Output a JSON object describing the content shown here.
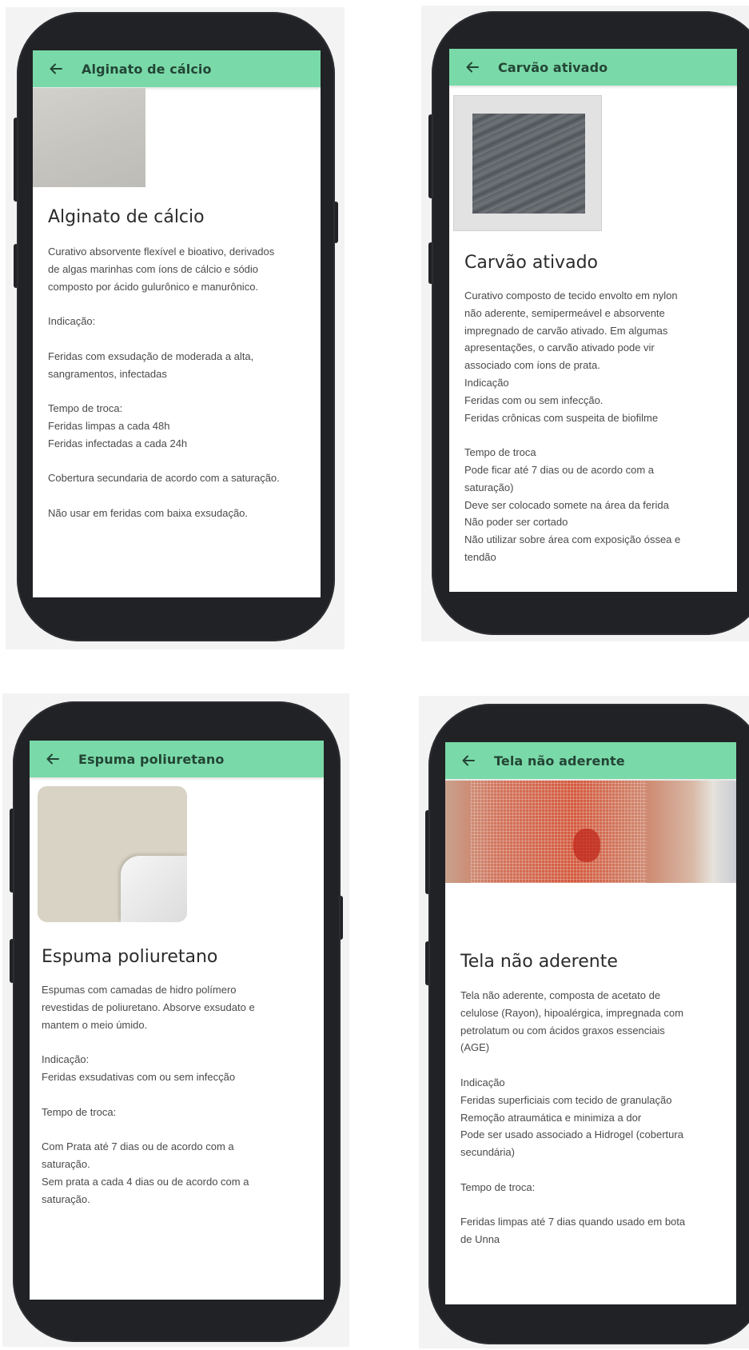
{
  "screens": [
    {
      "appbar_title": "Alginato de cálcio",
      "heading": "Alginato de cálcio",
      "image_icon": "gray-dressing-swatch",
      "lines": [
        "Curativo absorvente flexível e bioativo, derivados",
        "de algas marinhas com íons de cálcio e sódio",
        "composto por ácido gulurônico e manurônico.",
        "",
        "Indicação:",
        "",
        "Feridas com exsudação de moderada a alta,",
        "sangramentos, infectadas",
        "",
        "Tempo de troca:",
        "Feridas limpas a cada 48h",
        "Feridas infectadas a cada 24h",
        "",
        "Cobertura secundaria de acordo com a saturação.",
        "",
        "Não usar em feridas com baixa exsudação."
      ]
    },
    {
      "appbar_title": "Carvão ativado",
      "heading": "Carvão ativado",
      "image_icon": "activated-charcoal-dressing",
      "lines": [
        "Curativo composto de tecido envolto em nylon",
        "não aderente, semipermeável e absorvente",
        "impregnado de carvão ativado. Em algumas",
        "apresentações, o carvão ativado pode vir",
        "associado com íons de prata.",
        "Indicação",
        "Feridas com ou sem infecção.",
        "Feridas crônicas com suspeita de biofilme",
        "",
        "Tempo de troca",
        "Pode ficar até 7 dias ou de acordo com a",
        "saturação)",
        "Deve ser colocado somete na área da ferida",
        "Não poder ser cortado",
        "Não utilizar sobre área com exposição óssea e",
        "tendão"
      ]
    },
    {
      "appbar_title": "Espuma poliuretano",
      "heading": "Espuma poliuretano",
      "image_icon": "foam-dressing-pad",
      "lines": [
        "Espumas com camadas de hidro polímero",
        "revestidas de poliuretano. Absorve exsudato e",
        "mantem o meio úmido.",
        "",
        "Indicação:",
        "Feridas exsudativas com ou sem infecção",
        "",
        "Tempo de troca:",
        "",
        "Com Prata até 7 dias ou de acordo com a",
        "saturação.",
        "Sem prata a cada 4 dias ou de acordo com a",
        "saturação."
      ]
    },
    {
      "appbar_title": "Tela não aderente",
      "heading": "Tela não aderente",
      "image_icon": "non-adherent-mesh-on-wound",
      "lines": [
        "Tela não aderente, composta de acetato de",
        "celulose (Rayon), hipoalérgica, impregnada com",
        "petrolatum ou com ácidos graxos essenciais",
        "(AGE)",
        "",
        "Indicação",
        "Feridas superficiais com tecido de granulação",
        "Remoção atraumática e minimiza a dor",
        "Pode ser usado associado a Hidrogel (cobertura",
        "secundária)",
        "",
        "Tempo de troca:",
        "",
        "Feridas limpas até 7 dias quando usado em bota",
        "de Unna"
      ]
    }
  ],
  "colors": {
    "appbar": "#7ad9a8",
    "appbar_text": "#234536",
    "phone_body": "#202225",
    "screen_bg": "#ffffff",
    "body_text": "#4a4a4a"
  },
  "icons": {
    "back": "arrow-left-icon"
  }
}
